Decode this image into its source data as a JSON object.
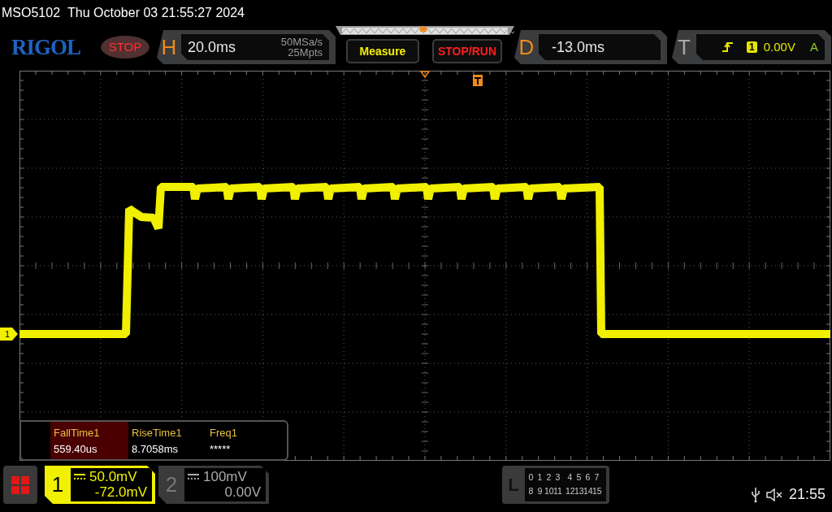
{
  "header": {
    "model": "MSO5102",
    "datetime": "Thu October 03 21:55:27 2024"
  },
  "toolbar": {
    "logo": "RIGOL",
    "run_state": "STOP",
    "horizontal": {
      "label": "H",
      "timebase": "20.0ms",
      "sample_rate": "50MSa/s",
      "memory_depth": "25Mpts"
    },
    "buttons": [
      {
        "label": "Measure",
        "kind": "measure"
      },
      {
        "label": "STOP/RUN",
        "kind": "run"
      }
    ],
    "delay": {
      "label": "D",
      "value": "-13.0ms"
    },
    "trigger": {
      "label": "T",
      "source": "1",
      "level": "0.00V",
      "mode": "A"
    }
  },
  "trace": {
    "channel_marker": "1"
  },
  "measurements": [
    {
      "name": "FallTime1",
      "value": "559.40us",
      "selected": true
    },
    {
      "name": "RiseTime1",
      "value": "8.7058ms",
      "selected": false
    },
    {
      "name": "Freq1",
      "value": "*****",
      "selected": false
    }
  ],
  "channels": [
    {
      "number": "1",
      "scale": "50.0mV",
      "offset": "-72.0mV",
      "on": true
    },
    {
      "number": "2",
      "scale": "100mV",
      "offset": "0.00V",
      "on": false
    }
  ],
  "logic": {
    "label": "L",
    "rows": [
      [
        "0",
        "1",
        "2",
        "3",
        "4",
        "5",
        "6",
        "7"
      ],
      [
        "8",
        "9",
        "10",
        "11",
        "12",
        "13",
        "14",
        "15"
      ]
    ]
  },
  "status": {
    "time": "21:55"
  }
}
